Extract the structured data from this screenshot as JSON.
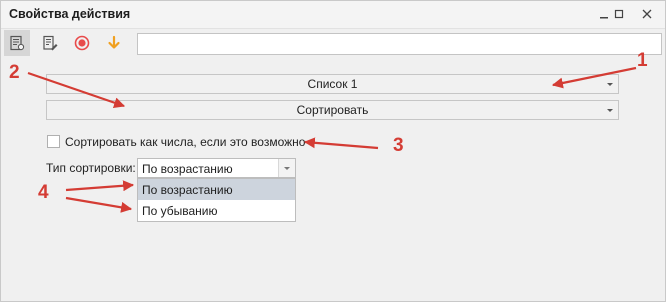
{
  "window": {
    "title": "Свойства действия"
  },
  "toolbar": {
    "icons": [
      "properties-icon",
      "edit-icon",
      "record-icon",
      "download-arrow-icon"
    ],
    "input_value": ""
  },
  "list_combo": {
    "value": "Список 1"
  },
  "op_combo": {
    "value": "Сортировать"
  },
  "numeric_checkbox": {
    "checked": false,
    "label": "Сортировать как числа, если это возможно"
  },
  "sort_type": {
    "label": "Тип сортировки:",
    "value": "По возрастанию",
    "options": [
      "По возрастанию",
      "По убыванию"
    ],
    "highlighted_index": 0
  },
  "annotations": {
    "n1": "1",
    "n2": "2",
    "n3": "3",
    "n4": "4"
  },
  "colors": {
    "annotation": "#d43c34",
    "record": "#e84a4a",
    "download": "#f0a020"
  }
}
